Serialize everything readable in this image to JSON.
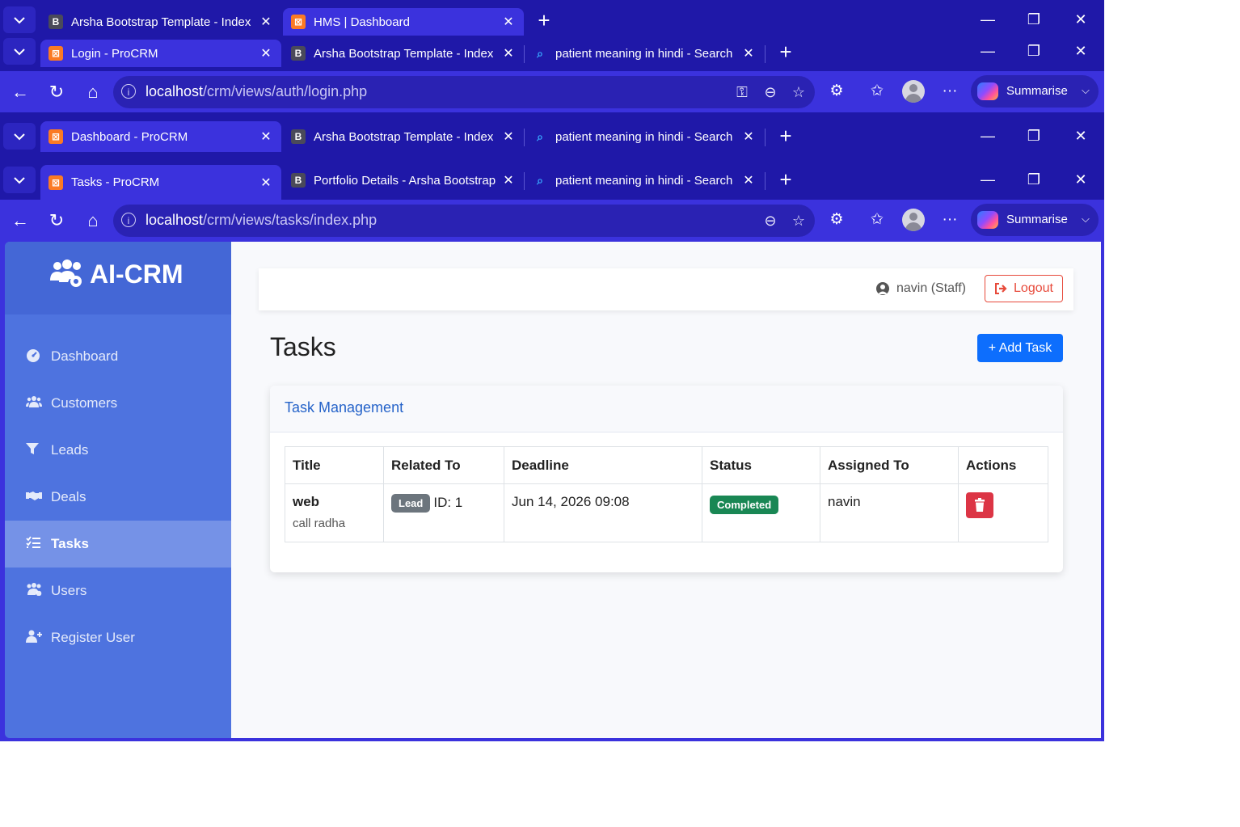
{
  "windows": [
    {
      "tabs": [
        {
          "icon": "b",
          "title": "Arsha Bootstrap Template - Index",
          "active": false
        },
        {
          "icon": "x",
          "title": "HMS | Dashboard",
          "active": true
        }
      ]
    },
    {
      "tabs": [
        {
          "icon": "x",
          "title": "Login - ProCRM",
          "active": true
        },
        {
          "icon": "b",
          "title": "Arsha Bootstrap Template - Index",
          "active": false
        },
        {
          "icon": "s",
          "title": "patient meaning in hindi - Search",
          "active": false
        }
      ],
      "url_host": "localhost",
      "url_path": "/crm/views/auth/login.php"
    },
    {
      "tabs": [
        {
          "icon": "x",
          "title": "Dashboard - ProCRM",
          "active": true
        },
        {
          "icon": "b",
          "title": "Arsha Bootstrap Template - Index",
          "active": false
        },
        {
          "icon": "s",
          "title": "patient meaning in hindi - Search",
          "active": false
        }
      ]
    },
    {
      "tabs": [
        {
          "icon": "x",
          "title": "Tasks - ProCRM",
          "active": true
        },
        {
          "icon": "b",
          "title": "Portfolio Details - Arsha Bootstrap",
          "active": false
        },
        {
          "icon": "s",
          "title": "patient meaning in hindi - Search",
          "active": false
        }
      ],
      "url_host": "localhost",
      "url_path": "/crm/views/tasks/index.php"
    }
  ],
  "browser": {
    "summarise_label": "Summarise"
  },
  "app": {
    "brand": "AI-CRM",
    "nav": [
      {
        "label": "Dashboard",
        "icon": "dashboard-icon",
        "active": false
      },
      {
        "label": "Customers",
        "icon": "users-icon",
        "active": false
      },
      {
        "label": "Leads",
        "icon": "filter-icon",
        "active": false
      },
      {
        "label": "Deals",
        "icon": "handshake-icon",
        "active": false
      },
      {
        "label": "Tasks",
        "icon": "tasks-icon",
        "active": true
      },
      {
        "label": "Users",
        "icon": "users-cog-icon",
        "active": false
      },
      {
        "label": "Register User",
        "icon": "user-plus-icon",
        "active": false
      }
    ],
    "user_label": "navin (Staff)",
    "logout_label": "Logout",
    "page_title": "Tasks",
    "add_task_label": "+ Add Task",
    "card_title": "Task Management",
    "table": {
      "columns": [
        "Title",
        "Related To",
        "Deadline",
        "Status",
        "Assigned To",
        "Actions"
      ],
      "rows": [
        {
          "title": "web",
          "description": "call radha",
          "related_badge": "Lead",
          "related_id": "ID: 1",
          "deadline": "Jun 14, 2026 09:08",
          "status": "Completed",
          "assigned": "navin"
        }
      ]
    }
  }
}
